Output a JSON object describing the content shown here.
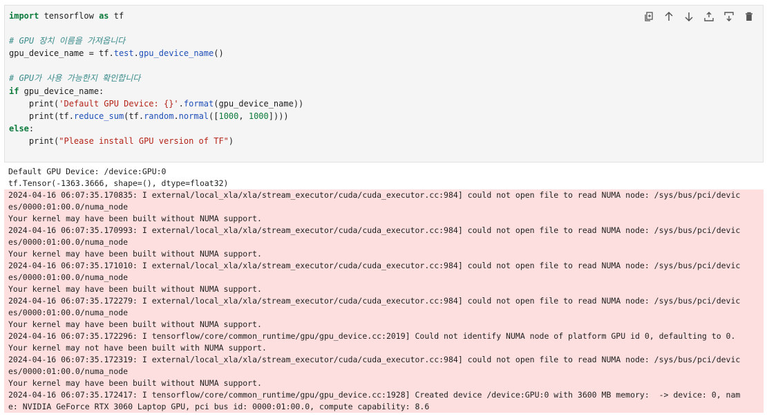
{
  "toolbar": {
    "buttons": [
      "duplicate",
      "move-up",
      "move-down",
      "insert-above",
      "insert-below",
      "delete"
    ]
  },
  "code": {
    "l1_kw": "import",
    "l1_rest": " tensorflow ",
    "l1_as": "as",
    "l1_tf": " tf",
    "l3_comment": "# GPU 장치 이름을 가져옵니다",
    "l4_a": "gpu_device_name = tf.",
    "l4_b": "test",
    "l4_c": ".",
    "l4_d": "gpu_device_name",
    "l4_e": "()",
    "l6_comment": "# GPU가 사용 가능한지 확인합니다",
    "l7_kw": "if",
    "l7_rest": " gpu_device_name:",
    "l8_a": "    print(",
    "l8_str": "'Default GPU Device: {}'",
    "l8_b": ".",
    "l8_fn": "format",
    "l8_c": "(gpu_device_name))",
    "l9_a": "    print(tf.",
    "l9_fn1": "reduce_sum",
    "l9_b": "(tf.",
    "l9_fn2": "random",
    "l9_c": ".",
    "l9_fn3": "normal",
    "l9_d": "([",
    "l9_n1": "1000",
    "l9_e": ", ",
    "l9_n2": "1000",
    "l9_f": "])))",
    "l10_kw": "else",
    "l10_rest": ":",
    "l11_a": "    print(",
    "l11_str": "\"Please install GPU version of TF\"",
    "l11_b": ")"
  },
  "stdout": [
    "Default GPU Device: /device:GPU:0",
    "tf.Tensor(-1363.3666, shape=(), dtype=float32)"
  ],
  "stderr": [
    "2024-04-16 06:07:35.170835: I external/local_xla/xla/stream_executor/cuda/cuda_executor.cc:984] could not open file to read NUMA node: /sys/bus/pci/devic",
    "es/0000:01:00.0/numa_node",
    "Your kernel may have been built without NUMA support.",
    "2024-04-16 06:07:35.170993: I external/local_xla/xla/stream_executor/cuda/cuda_executor.cc:984] could not open file to read NUMA node: /sys/bus/pci/devic",
    "es/0000:01:00.0/numa_node",
    "Your kernel may have been built without NUMA support.",
    "2024-04-16 06:07:35.171010: I external/local_xla/xla/stream_executor/cuda/cuda_executor.cc:984] could not open file to read NUMA node: /sys/bus/pci/devic",
    "es/0000:01:00.0/numa_node",
    "Your kernel may have been built without NUMA support.",
    "2024-04-16 06:07:35.172279: I external/local_xla/xla/stream_executor/cuda/cuda_executor.cc:984] could not open file to read NUMA node: /sys/bus/pci/devic",
    "es/0000:01:00.0/numa_node",
    "Your kernel may have been built without NUMA support.",
    "2024-04-16 06:07:35.172296: I tensorflow/core/common_runtime/gpu/gpu_device.cc:2019] Could not identify NUMA node of platform GPU id 0, defaulting to 0.",
    "Your kernel may not have been built with NUMA support.",
    "2024-04-16 06:07:35.172319: I external/local_xla/xla/stream_executor/cuda/cuda_executor.cc:984] could not open file to read NUMA node: /sys/bus/pci/devic",
    "es/0000:01:00.0/numa_node",
    "Your kernel may have been built without NUMA support.",
    "2024-04-16 06:07:35.172417: I tensorflow/core/common_runtime/gpu/gpu_device.cc:1928] Created device /device:GPU:0 with 3600 MB memory:  -> device: 0, nam",
    "e: NVIDIA GeForce RTX 3060 Laptop GPU, pci bus id: 0000:01:00.0, compute capability: 8.6"
  ],
  "colors": {
    "cell_bg": "#f5f5f5",
    "stderr_bg": "#fddfdf",
    "keyword": "#0b7a3a",
    "comment": "#3b8b8b",
    "string": "#b42318",
    "function": "#1f4fb8"
  }
}
